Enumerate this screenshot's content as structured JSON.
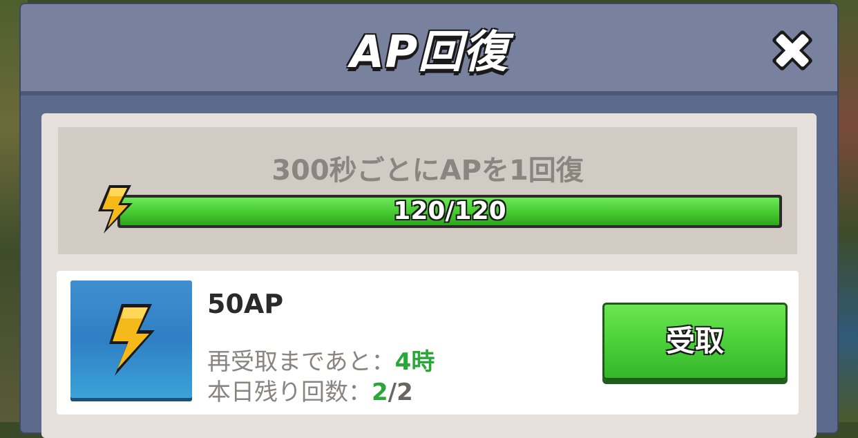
{
  "dialog": {
    "title": "AP回復",
    "close_icon": "close-icon"
  },
  "recovery": {
    "text": "300秒ごとにAPを1回復",
    "current": 120,
    "max": 120,
    "bar_label": "120/120",
    "fill_fraction": 1.0,
    "icon": "lightning-bolt-icon"
  },
  "reward": {
    "name": "50AP",
    "icon": "lightning-bolt-icon",
    "cooldown_label": "再受取まであと：",
    "cooldown_value": "4時",
    "remaining_label": "本日残り回数：",
    "remaining_value": "2/2",
    "claim_label": "受取"
  },
  "colors": {
    "accent_green": "#45c92f",
    "header": "#78829e",
    "panel": "#e6e0dc",
    "icon_tile": "#2f7fc4"
  }
}
